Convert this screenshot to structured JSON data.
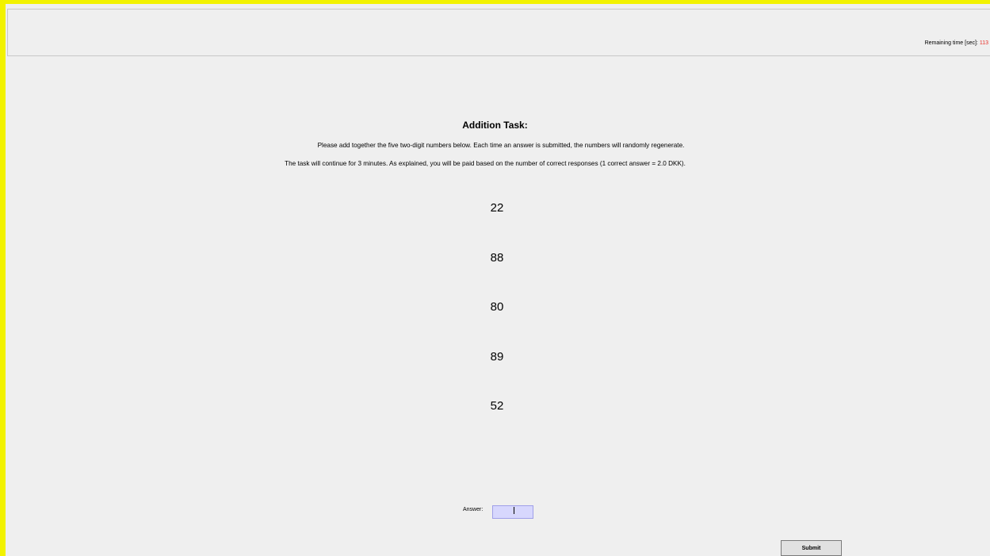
{
  "header": {
    "timer_label": "Remaining time [sec]:",
    "timer_value": "113"
  },
  "task": {
    "title": "Addition Task:",
    "instruction_1": "Please add together the five two-digit numbers below. Each time an answer is submitted, the numbers will randomly regenerate.",
    "instruction_2": "The task will continue for 3 minutes.  As explained, you will be paid based on the number of correct responses (1 correct answer = 2.0 DKK).",
    "numbers": [
      "22",
      "88",
      "80",
      "89",
      "52"
    ]
  },
  "form": {
    "answer_label": "Answer:",
    "answer_value": "",
    "submit_label": "Submit"
  },
  "colors": {
    "frame": "#f2f200",
    "timer_value": "#e8302a",
    "input_bg": "#d7d7fd"
  }
}
